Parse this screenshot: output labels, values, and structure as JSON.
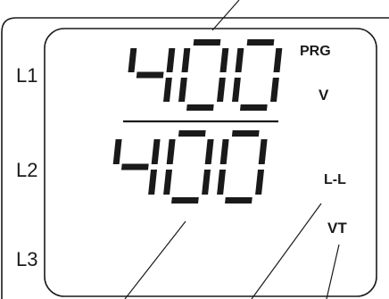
{
  "display": {
    "upper_value": "400",
    "lower_value": "400",
    "phase_labels": [
      "L1",
      "L2",
      "L3"
    ],
    "indicator_prg": "PRG",
    "indicator_unit": "V",
    "indicator_mode": "L-L",
    "indicator_vt": "VT"
  },
  "colors": {
    "ink": "#1a1a1a",
    "background": "#ffffff"
  }
}
